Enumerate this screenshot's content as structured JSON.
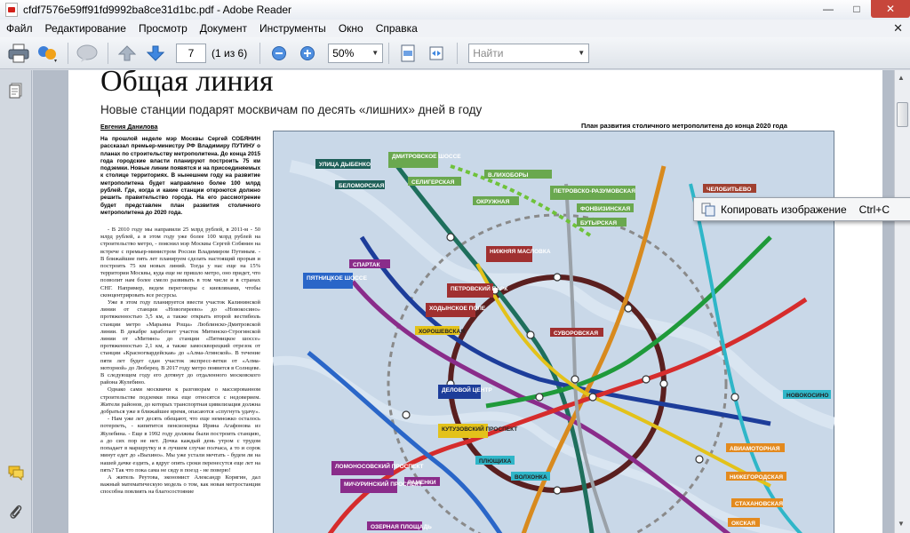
{
  "app": {
    "title": "cfdf7576e59ff91fd9992ba8ce31d1bc.pdf - Adobe Reader",
    "window_buttons": {
      "minimize": "—",
      "maximize": "□",
      "close": "✕"
    }
  },
  "menu": {
    "items": [
      "Файл",
      "Редактирование",
      "Просмотр",
      "Документ",
      "Инструменты",
      "Окно",
      "Справка"
    ],
    "close_glyph": "✕"
  },
  "toolbar": {
    "page_number": "7",
    "page_count": "(1 из 6)",
    "zoom": "50%",
    "find_placeholder": "Найти"
  },
  "article": {
    "headline": "Общая линия",
    "subhead": "Новые станции подарят москвичам по десять «лишних» дней в году",
    "author": "Евгения Данилова",
    "lead": "На прошлой неделе мэр Москвы Сергей СОБЯНИН рассказал премьер-министру РФ Владимиру ПУТИНУ о планах по строительству метрополитена. До конца 2015 года городские власти планируют построить 75 км подземки. Новые линии появятся и на присоединяемых к столице территориях. В нынешнем году на развитие метрополитена будет направлено более 100 млрд рублей. Где, когда и какие станции откроются должно решить правительство города. На его рассмотрение будет представлен план развития столичного метрополитена до 2020 года.",
    "paragraphs": [
      "- В 2010 году мы направили 25 млрд рублей, в 2011-м - 50 млрд рублей, а в этом году уже более 100 млрд рублей на строительство метро, - пояснил мэр Москвы Сергей Собянин на встрече с премьер-министром России Владимиром Путиным. - В ближайшие пять лет планируем сделать настоящий прорыв и построить 75 км новых линий. Тогда у нас еще на 15% территории Москвы, куда еще не пришло метро, оно придет, что позволит нам более смело развивать в том числе и в странах СНГ. Например, ведем переговоры с киевлянами, чтобы сконцентрировать все ресурсы.",
      "Уже в этом году планируется ввести участок Калининской линии от станции «Новогиреево» до «Новокосино» протяженностью 3,5 км, а также открыть второй вестибюль станции метро «Марьина Роща» Люблинско-Дмитровской линии. В декабре заработает участок Митинско-Строгинской линии от «Митино» до станции «Пятницкое шоссе» протяженностью 2,1 км, а также замоскворецкий отрезок от станции «Красногвардейская» до «Алма-Атинской». В течение пяти лет будет сдан участок экспресс-ветки от «Алма-моторной» до Люберец. В 2017 году метро появится в Солнцеве. В следующем году его дотянут до отдаленного московского района Жулебино.",
      "Однако сами москвичи к разговорам о массированном строительстве подземки пока еще относятся с недоверием. Жители районов, до которых транспортная цивилизация должна добраться уже в ближайшее время, опасаются «спугнуть удачу».",
      "- Нам уже лет десять обещают, что еще немножко осталось потерпеть, - кипятится пенсионерка Ирина Агафонова из Жулебина. - Еще в 1992 году должны были построить станцию, а до сих пор не нет. Дочка каждый день утром с трудом попадает в маршрутку и в лучшем случае полчаса, а то и сорок минут едет до «Выхино». Мы уже устали мечтать - будем ли на нашей дачке ездить, а вдруг опять сроки перенесутся еще лет на пять? Так что пока сама не сяду в поезд - не поверю!",
      "А житель Реутова, экономист Александр Корягин, дал важный математическую модель о том, как новая метростанция способна повлиять на благосостояние"
    ],
    "map_caption": "План развития столичного метрополитена до конца 2020 года"
  },
  "metro_map": {
    "stations": [
      "УЛИЦА ДЫБЕНКО",
      "ДМИТРОВСКОЕ ШОССЕ",
      "БЕЛОМОРСКАЯ",
      "СЕЛИГЕРСКАЯ",
      "В.ЛИХОБОРЫ",
      "ОКРУЖНАЯ",
      "ПЕТРОВСКО-РАЗУМОВСКАЯ",
      "ФОНВИЗИНСКАЯ",
      "БУТЫРСКАЯ",
      "ЧЕЛОБИТЬЕВО",
      "НИЖНЯЯ МАСЛОВКА",
      "ПЕТРОВСКИЙ ПАРК",
      "СПАРТАК",
      "ПЯТНИЦКОЕ ШОССЕ",
      "ХОДЫНСКОЕ ПОЛЕ",
      "ХОРОШЕВСКАЯ",
      "СУВОРОВСКАЯ",
      "ДЕЛОВОЙ ЦЕНТР",
      "КУТУЗОВСКИЙ ПРОСПЕКТ",
      "ПЛЮЩИХА",
      "ВОЛХОНКА",
      "НОВОКОСИНО",
      "ЛОМОНОСОВСКИЙ ПРОСПЕКТ",
      "РАМЕНКИ",
      "МИЧУРИНСКИЙ ПРОСПЕКТ",
      "АВИАМОТОРНАЯ",
      "НИЖЕГОРОДСКАЯ",
      "СТАХАНОВСКАЯ",
      "ОКСКАЯ",
      "ОЗЕРНАЯ ПЛОЩАДЬ"
    ]
  },
  "context_menu": {
    "label": "Копировать изображение",
    "shortcut": "Ctrl+C"
  }
}
